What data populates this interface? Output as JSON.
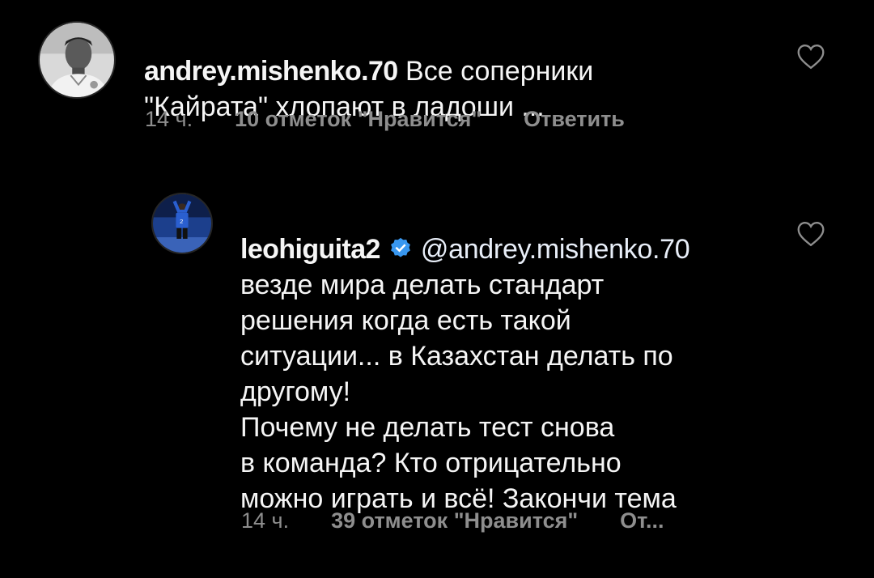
{
  "comments": [
    {
      "username": "andrey.mishenko.70",
      "text_line1": " Все соперники",
      "text_rest": "\"Кайрата\" хлопают в ладоши ...",
      "time": "14 ч.",
      "likes": "10 отметок \"Нравится\"",
      "reply": "Ответить",
      "avatar_icon": "user-photo-avatar",
      "like_icon": "heart-outline-icon"
    },
    {
      "username": "leohiguita2",
      "verified_icon": "verified-badge-icon",
      "mention": "@andrey.mishenko.70",
      "text": "везде мира делать стандарт\nрешения когда есть такой\nситуации... в Казахстан делать по\nдругому!\nПочему не делать тест снова\nв команда? Кто отрицательно\nможно играть и всё! Закончи тема",
      "time": "14 ч.",
      "likes": "39 отметок \"Нравится\"",
      "reply": "От...",
      "avatar_icon": "goalkeeper-photo-avatar",
      "like_icon": "heart-outline-icon"
    }
  ],
  "colors": {
    "background": "#000000",
    "text": "#f5f5f5",
    "meta": "#8e8e8e",
    "verified": "#3897f0"
  }
}
